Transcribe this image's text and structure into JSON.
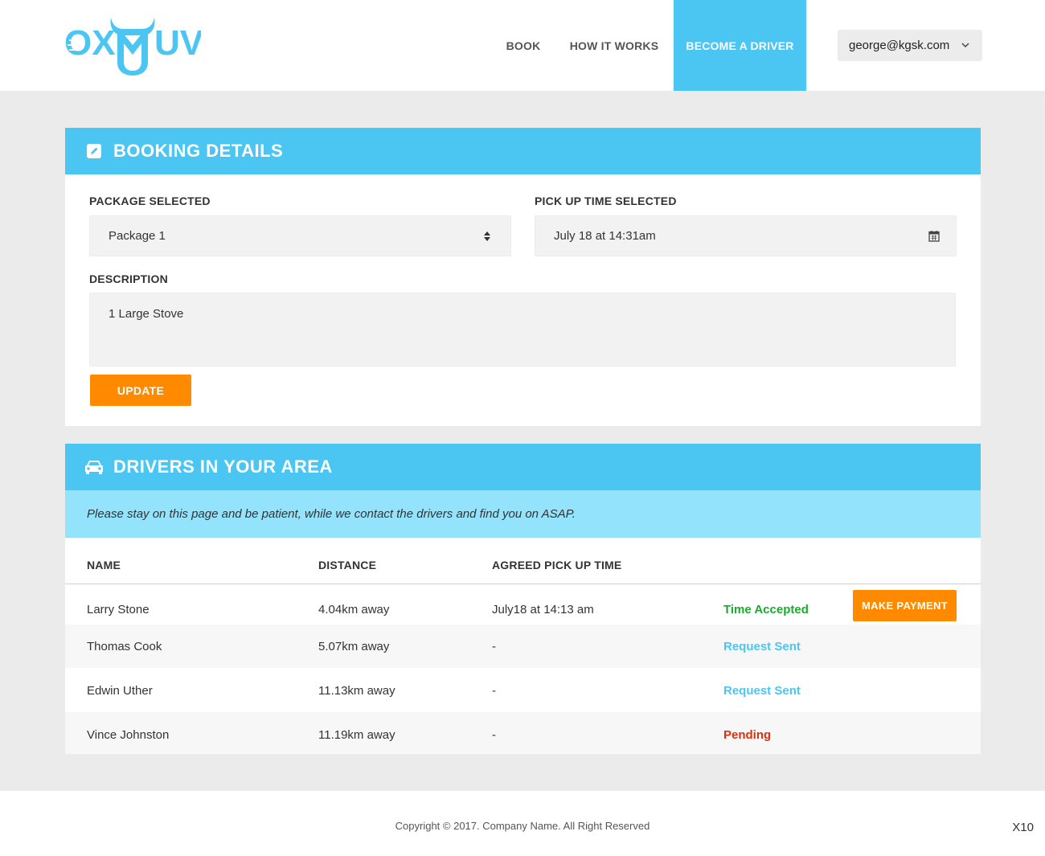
{
  "brand": {
    "logo_text": "OXMUV",
    "color": "#4bc6f3",
    "accent": "#ff8a00"
  },
  "nav": {
    "items": [
      {
        "label": "BOOK"
      },
      {
        "label": "HOW IT WORKS"
      },
      {
        "label": "BECOME A DRIVER"
      }
    ],
    "user_email": "george@kgsk.com"
  },
  "booking": {
    "title": "BOOKING DETAILS",
    "icon": "edit-icon",
    "package_label": "PACKAGE SELECTED",
    "package_value": "Package 1",
    "pickup_label": "PICK UP TIME SELECTED",
    "pickup_value": "July 18 at 14:31am",
    "description_label": "DESCRIPTION",
    "description_value": "1 Large Stove",
    "update_label": "UPDATE"
  },
  "drivers": {
    "title": "DRIVERS IN YOUR AREA",
    "icon": "car-icon",
    "notice": "Please stay on this page and be patient, while we contact the drivers and find you on ASAP.",
    "columns": [
      "NAME",
      "DISTANCE",
      "AGREED PICK UP TIME"
    ],
    "rows": [
      {
        "name": "Larry Stone",
        "distance": "4.04km away",
        "time": "July18 at 14:13 am",
        "status": "Time Accepted",
        "status_color": "#1aab2e",
        "action": "MAKE PAYMENT"
      },
      {
        "name": "Thomas Cook",
        "distance": "5.07km away",
        "time": "-",
        "status": "Request Sent",
        "status_color": "#4bc6f3"
      },
      {
        "name": "Edwin Uther",
        "distance": "11.13km away",
        "time": "-",
        "status": "Request Sent",
        "status_color": "#4bc6f3"
      },
      {
        "name": "Vince Johnston",
        "distance": "11.19km away",
        "time": "-",
        "status": "Pending",
        "status_color": "#d9320f"
      }
    ]
  },
  "footer": {
    "copyright": "Copyright © 2017. Company Name. All Right Reserved",
    "corner_label": "X10"
  }
}
